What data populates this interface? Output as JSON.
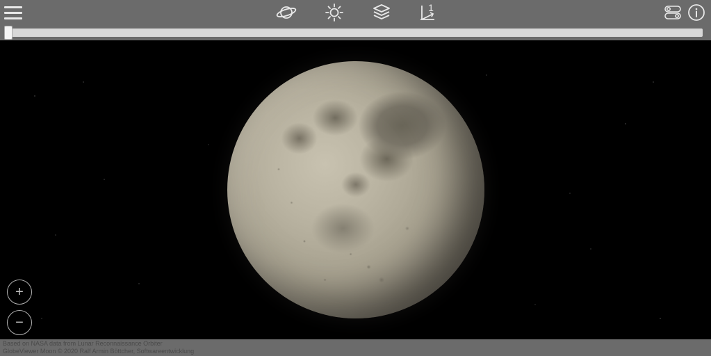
{
  "toolbar": {
    "menu_label": "menu",
    "planet_label": "planet",
    "sun_label": "sun",
    "layers_label": "layers",
    "scale_label": "scale",
    "scale_value": "1",
    "settings_label": "settings",
    "info_label": "info"
  },
  "slider": {
    "value": 0,
    "min": 0,
    "max": 100
  },
  "zoom": {
    "in_label": "+",
    "out_label": "−"
  },
  "footer": {
    "line1": "Based on NASA data from Lunar Reconnaissance Orbiter",
    "line2": "GlobeViewer Moon © 2020 Ralf Armin Böttcher, Softwareentwicklung"
  },
  "body": {
    "name": "Moon"
  }
}
